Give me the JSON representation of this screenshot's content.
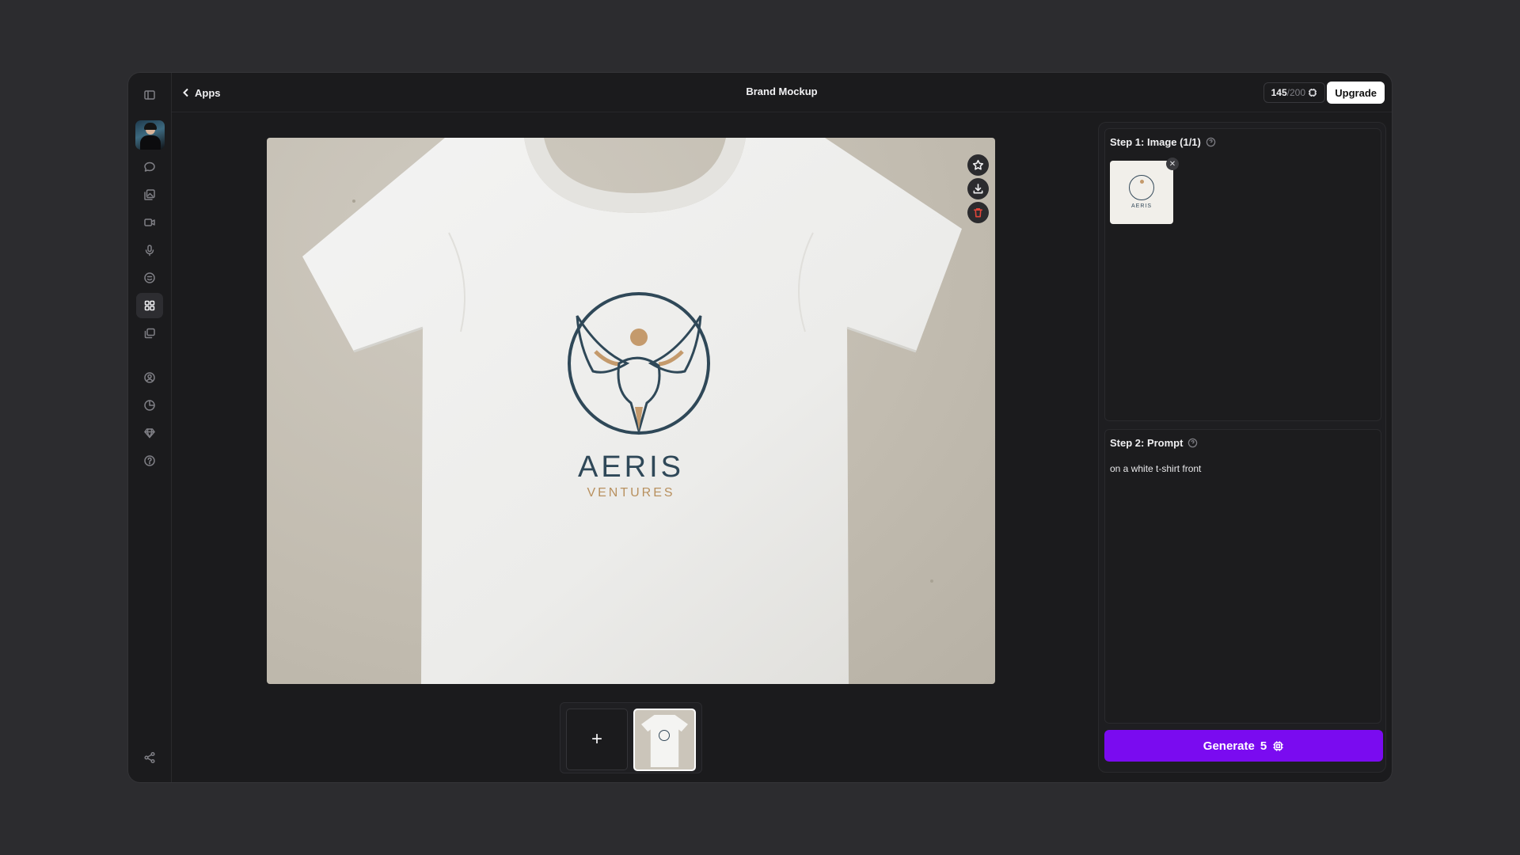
{
  "header": {
    "back_label": "Apps",
    "title": "Brand Mockup",
    "credits_used": "145",
    "credits_max": "/200",
    "upgrade_label": "Upgrade"
  },
  "sidebar": {
    "items": [
      {
        "icon": "chat-icon"
      },
      {
        "icon": "image-gallery-icon"
      },
      {
        "icon": "video-icon"
      },
      {
        "icon": "microphone-icon"
      },
      {
        "icon": "face-icon"
      },
      {
        "icon": "apps-grid-icon",
        "active": true
      },
      {
        "icon": "layers-icon"
      },
      {
        "icon": "user-circle-icon"
      },
      {
        "icon": "history-icon"
      },
      {
        "icon": "diamond-icon"
      },
      {
        "icon": "help-icon"
      },
      {
        "icon": "share-icon"
      }
    ]
  },
  "preview": {
    "logo_title": "AERIS",
    "logo_subtitle": "VENTURES",
    "actions": [
      "favorite-icon",
      "download-icon",
      "delete-icon"
    ]
  },
  "steps": {
    "step1_title": "Step 1: Image (1/1)",
    "step2_title": "Step 2: Prompt",
    "prompt_text": "on a white t-shirt front"
  },
  "thumb_logo_label": "AERIS",
  "generate": {
    "label": "Generate",
    "cost": "5"
  },
  "colors": {
    "accent": "#7a0bf0",
    "logo_navy": "#2f4858",
    "logo_gold": "#b8905e"
  }
}
